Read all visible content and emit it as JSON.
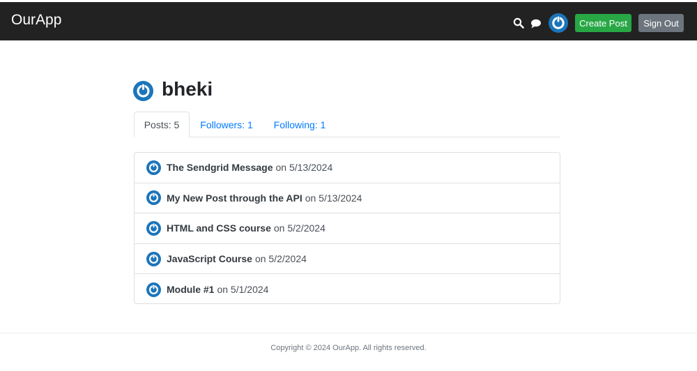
{
  "header": {
    "brand": "OurApp",
    "create_post_label": "Create Post",
    "sign_out_label": "Sign Out",
    "icons": [
      "search-icon",
      "chat-icon",
      "avatar-icon"
    ]
  },
  "profile": {
    "username": "bheki",
    "tabs": [
      {
        "label": "Posts: 5",
        "active": true
      },
      {
        "label": "Followers: 1",
        "active": false
      },
      {
        "label": "Following: 1",
        "active": false
      }
    ]
  },
  "posts": [
    {
      "title": "The Sendgrid Message",
      "date": "on 5/13/2024"
    },
    {
      "title": "My New Post through the API",
      "date": "on 5/13/2024"
    },
    {
      "title": "HTML and CSS course",
      "date": "on 5/2/2024"
    },
    {
      "title": "JavaScript Course",
      "date": "on 5/2/2024"
    },
    {
      "title": "Module #1",
      "date": "on 5/1/2024"
    }
  ],
  "footer": {
    "copyright": "Copyright © 2024 OurApp. All rights reserved."
  },
  "colors": {
    "header_bg": "#222222",
    "create_button": "#28a745",
    "sign_out_button": "#6c757d",
    "link": "#007bff",
    "avatar_blue": "#1b75bb"
  }
}
